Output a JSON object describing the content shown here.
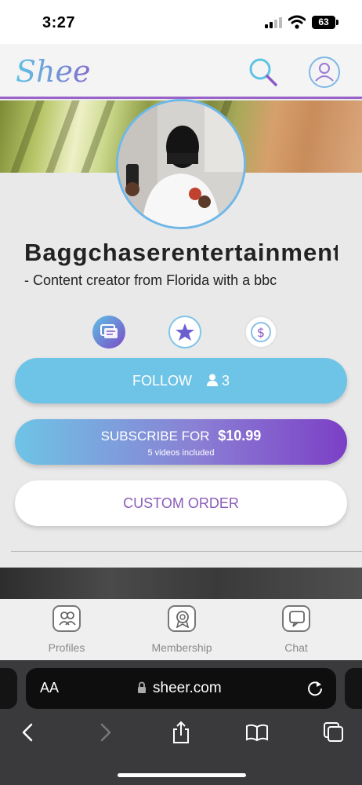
{
  "status_bar": {
    "time": "3:27",
    "battery": "63"
  },
  "header": {
    "logo_text": "Sheer"
  },
  "profile": {
    "username": "Baggchaserentertainment",
    "bio": "- Content creator from Florida with a bbc"
  },
  "actions": {
    "follow_label": "FOLLOW",
    "follow_count": "3",
    "subscribe_label": "SUBSCRIBE FOR",
    "subscribe_price": "$10.99",
    "subscribe_note": "5 videos included",
    "custom_order_label": "CUSTOM ORDER"
  },
  "bottom_nav": {
    "items": [
      {
        "label": "Profiles",
        "icon": "profiles-icon"
      },
      {
        "label": "Membership",
        "icon": "membership-icon"
      },
      {
        "label": "Chat",
        "icon": "chat-icon"
      }
    ]
  },
  "browser": {
    "aa_label": "AA",
    "url": "sheer.com"
  },
  "colors": {
    "accent_blue": "#6ec4e6",
    "accent_purple": "#7c3fc6",
    "custom_order_text": "#8b5db8"
  }
}
